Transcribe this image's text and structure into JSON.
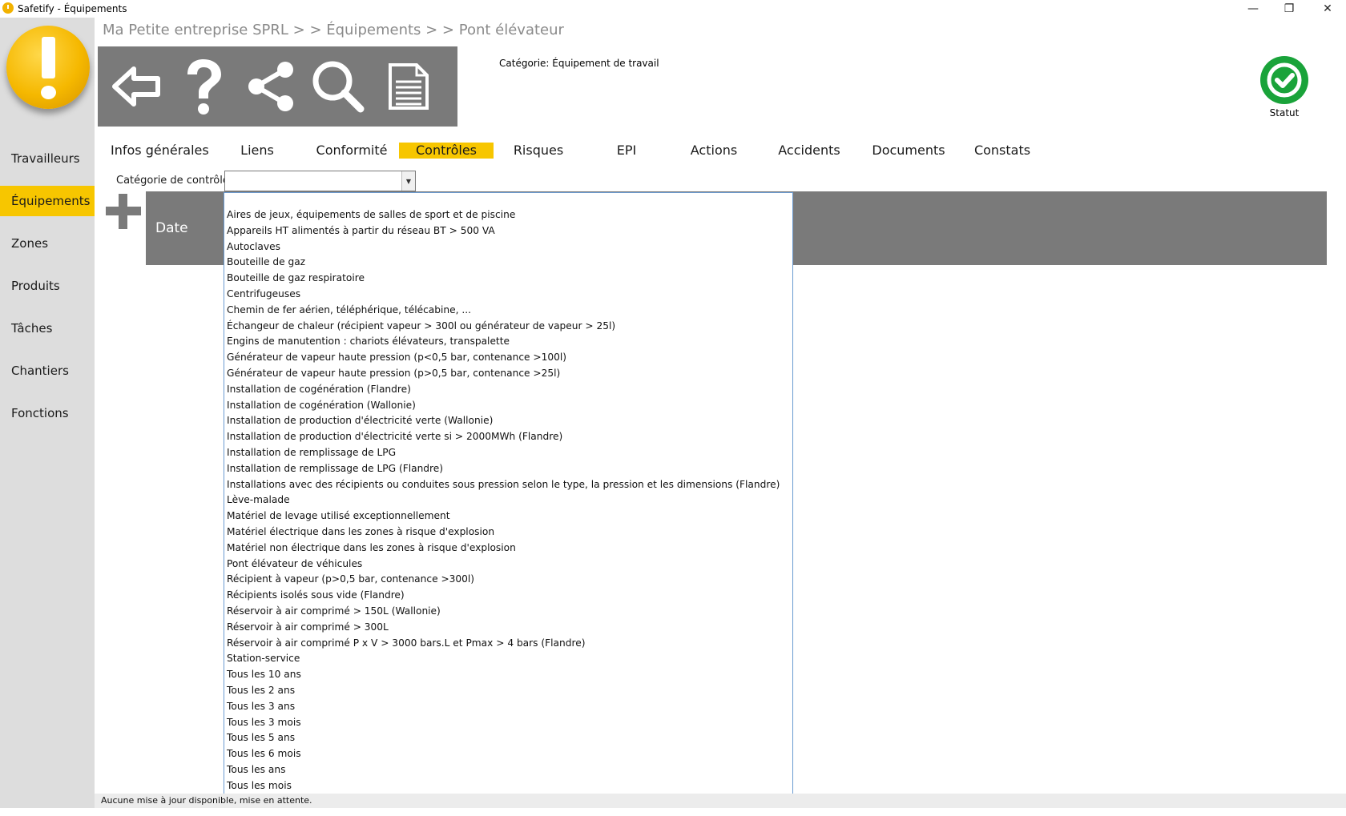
{
  "window": {
    "title": "Safetify - Équipements",
    "minimize_glyph": "—",
    "maximize_glyph": "❐",
    "close_glyph": "✕"
  },
  "sidebar": {
    "logo_icon": "exclamation-logo-icon",
    "items": [
      {
        "label": "Travailleurs",
        "active": false
      },
      {
        "label": "Équipements",
        "active": true
      },
      {
        "label": "Zones",
        "active": false
      },
      {
        "label": "Produits",
        "active": false
      },
      {
        "label": "Tâches",
        "active": false
      },
      {
        "label": "Chantiers",
        "active": false
      },
      {
        "label": "Fonctions",
        "active": false
      }
    ]
  },
  "breadcrumb": "Ma Petite entreprise SPRL  > >  Équipements  > >  Pont élévateur",
  "toolbar": {
    "icons": [
      "back-arrow-icon",
      "help-icon",
      "share-icon",
      "search-icon",
      "document-icon"
    ]
  },
  "category_label": "Catégorie: Équipement de travail",
  "status": {
    "label": "Statut",
    "icon": "check-icon",
    "color": "#1aa33a"
  },
  "tabs": [
    {
      "label": "Infos générales",
      "active": false
    },
    {
      "label": "Liens",
      "active": false
    },
    {
      "label": "Conformité",
      "active": false
    },
    {
      "label": "Contrôles",
      "active": true
    },
    {
      "label": "Risques",
      "active": false
    },
    {
      "label": "EPI",
      "active": false
    },
    {
      "label": "Actions",
      "active": false
    },
    {
      "label": "Accidents",
      "active": false
    },
    {
      "label": "Documents",
      "active": false
    },
    {
      "label": "Constats",
      "active": false
    }
  ],
  "filter": {
    "label": "Catégorie de contrôle:",
    "value": "",
    "options": [
      "Aires de jeux, équipements de salles de sport et de piscine",
      "Appareils HT alimentés à partir du réseau BT > 500 VA",
      "Autoclaves",
      "Bouteille de gaz",
      "Bouteille de gaz respiratoire",
      "Centrifugeuses",
      "Chemin de fer aérien, téléphérique, télécabine, ...",
      "Échangeur de chaleur (récipient vapeur > 300l ou générateur de vapeur > 25l)",
      "Engins de manutention : chariots élévateurs, transpalette",
      "Générateur de vapeur haute pression (p<0,5 bar, contenance >100l)",
      "Générateur de vapeur haute pression (p>0,5 bar, contenance >25l)",
      "Installation de cogénération (Flandre)",
      "Installation de cogénération (Wallonie)",
      "Installation de production d'électricité verte (Wallonie)",
      "Installation de production d'électricité verte si > 2000MWh (Flandre)",
      "Installation de remplissage de LPG",
      "Installation de remplissage de LPG (Flandre)",
      "Installations avec des récipients ou conduites sous pression selon le type, la pression et les dimensions (Flandre)",
      "Lève-malade",
      "Matériel de levage utilisé exceptionnellement",
      "Matériel électrique dans les zones à risque d'explosion",
      "Matériel non électrique dans les zones à risque d'explosion",
      "Pont élévateur de véhicules",
      "Récipient à vapeur (p>0,5 bar, contenance >300l)",
      "Récipients isolés sous vide (Flandre)",
      "Réservoir à air comprimé > 150L (Wallonie)",
      "Réservoir à air comprimé > 300L",
      "Réservoir à air comprimé P x V > 3000 bars.L et Pmax > 4 bars (Flandre)",
      "Station-service",
      "Tous les 10 ans",
      "Tous les 2 ans",
      "Tous les 3 ans",
      "Tous les 3 mois",
      "Tous les 5 ans",
      "Tous les 6 mois",
      "Tous les ans",
      "Tous les mois"
    ]
  },
  "grid": {
    "columns": [
      "Date"
    ],
    "add_icon": "plus-icon"
  },
  "statusbar": "Aucune mise à jour disponible, mise en attente.",
  "colors": {
    "accent": "#f7c600",
    "toolbar": "#7a7a7a",
    "sidebar": "#dddddd"
  }
}
